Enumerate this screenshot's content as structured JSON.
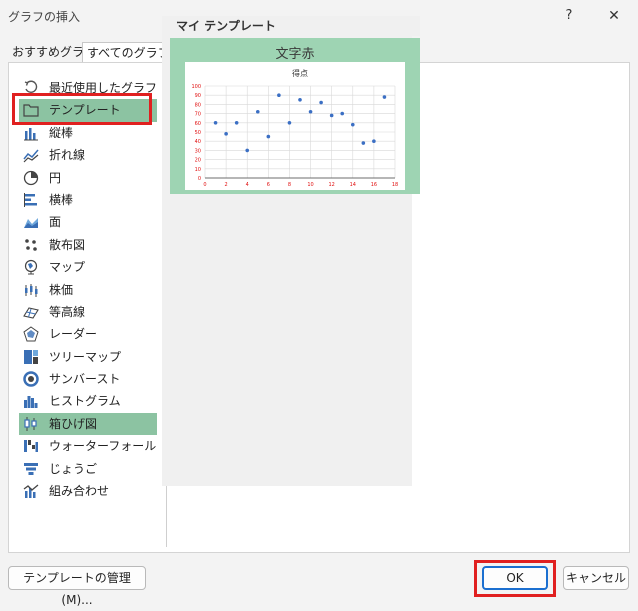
{
  "window": {
    "title": "グラフの挿入",
    "help_label": "?",
    "close_label": "✕"
  },
  "tabs": [
    {
      "label": "おすすめグラフ",
      "selected": false
    },
    {
      "label": "すべてのグラフ",
      "selected": true
    }
  ],
  "chart_types": [
    {
      "label": "最近使用したグラフ",
      "icon": "recent-icon"
    },
    {
      "label": "テンプレート",
      "icon": "folder-icon",
      "selected": true
    },
    {
      "label": "縦棒",
      "icon": "column-chart-icon"
    },
    {
      "label": "折れ線",
      "icon": "line-chart-icon"
    },
    {
      "label": "円",
      "icon": "pie-chart-icon"
    },
    {
      "label": "横棒",
      "icon": "bar-chart-icon"
    },
    {
      "label": "面",
      "icon": "area-chart-icon"
    },
    {
      "label": "散布図",
      "icon": "scatter-chart-icon"
    },
    {
      "label": "マップ",
      "icon": "map-chart-icon"
    },
    {
      "label": "株価",
      "icon": "stock-chart-icon"
    },
    {
      "label": "等高線",
      "icon": "surface-chart-icon"
    },
    {
      "label": "レーダー",
      "icon": "radar-chart-icon"
    },
    {
      "label": "ツリーマップ",
      "icon": "treemap-chart-icon"
    },
    {
      "label": "サンバースト",
      "icon": "sunburst-chart-icon"
    },
    {
      "label": "ヒストグラム",
      "icon": "histogram-chart-icon"
    },
    {
      "label": "箱ひげ図",
      "icon": "box-whisker-chart-icon",
      "highlighted": true
    },
    {
      "label": "ウォーターフォール",
      "icon": "waterfall-chart-icon"
    },
    {
      "label": "じょうご",
      "icon": "funnel-chart-icon"
    },
    {
      "label": "組み合わせ",
      "icon": "combo-chart-icon"
    }
  ],
  "templates": {
    "section_title": "マイ テンプレート",
    "items": [
      {
        "name": "文字赤"
      }
    ]
  },
  "chart_data": {
    "type": "scatter",
    "title": "得点",
    "x": [
      1,
      2,
      3,
      4,
      5,
      6,
      7,
      8,
      9,
      10,
      11,
      12,
      13,
      14,
      15,
      16,
      17
    ],
    "y": [
      60,
      48,
      60,
      30,
      72,
      45,
      90,
      60,
      85,
      72,
      82,
      68,
      70,
      58,
      38,
      40,
      88
    ],
    "xlim": [
      0,
      18
    ],
    "ylim": [
      0,
      100
    ],
    "x_ticks": [
      0,
      2,
      4,
      6,
      8,
      10,
      12,
      14,
      16,
      18
    ],
    "y_ticks": [
      0,
      10,
      20,
      30,
      40,
      50,
      60,
      70,
      80,
      90,
      100
    ],
    "grid": true,
    "legend": false,
    "colors": {
      "point": "#3b6fc4",
      "tick_label": "#e01010",
      "grid": "#d8d8d8"
    }
  },
  "buttons": {
    "manage_templates": "テンプレートの管理(M)...",
    "ok": "OK",
    "cancel": "キャンセル"
  },
  "highlight_color": "#e02020"
}
